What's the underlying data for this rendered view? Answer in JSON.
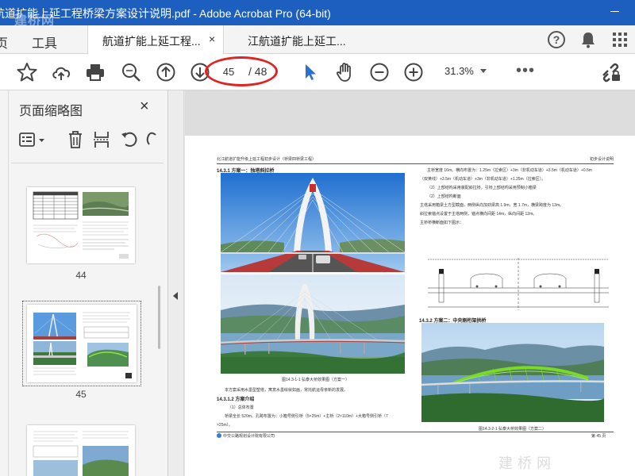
{
  "window": {
    "title": "航道扩能上延工程桥梁方案设计说明.pdf - Adobe Acrobat Pro (64-bit)",
    "watermark_text": "建桥网"
  },
  "tabs": {
    "home_label": "页",
    "tools_label": "工具",
    "active_doc_label": "航道扩能上延工程...",
    "second_doc_label": "江航道扩能上延工...",
    "close_symbol": "×",
    "help_symbol": "?"
  },
  "toolbar": {
    "current_page": "45",
    "total_pages": "/ 48",
    "zoom": "31.3%",
    "more_symbol": "•••",
    "annotation_color": "#e02424"
  },
  "left_panel": {
    "title": "页面缩略图",
    "close_symbol": "×",
    "thumbnails": [
      {
        "page_label": "44"
      },
      {
        "page_label": "45"
      }
    ]
  },
  "document": {
    "header_left": "北江航道扩能升级上延工程初步设计（桥梁四桥梁工程）",
    "header_right": "初步设计说明",
    "section_1": "14.3.1 方案一：独塔斜拉桥",
    "para_1": "本方案采用水墨型塑塔，寓意水墨绘就如画，常托航运母亲新的发展。",
    "section_1_2": "14.3.1.2 方案介绍",
    "para_2": "（1）总体布置",
    "para_3": "桥梁全长 520m。孔跨布置为：小箱号侧引桥（5×25m）+主桥（2×110m）+大箱号侧引桥（7",
    "para_4": "×25m）。",
    "caption_1": "图14.3-1-1  弘泰大桥效果图（方案一）",
    "right_para_1": "主桥宽度 16m。横向布置为：1.25m（拉索区）+3m（非机动车道）+3.5m（机动车道）+0.5m",
    "right_para_2": "（双黄线）+3.5m（机动车道）+3m（非机动车道）+1.25m（拉索区）。",
    "right_para_3": "（2）上部结构采用装配斜拉桥，引桥上部结构采用预制小箱梁",
    "right_para_4": "（2）上部结构断面",
    "right_para_5": "主塔采用箱梁土方型截面，两侧纵向加劲梁高 1.9m，宽 1.7m，横梁跨度为 13m。",
    "right_para_6": "斜拉索锚点设置于主塔两侧，锚点横向间距 14m，纵向间距 12m。",
    "right_para_7": "主桥桥横断面如下图示：",
    "section_2": "14.3.2 方案二：中央刚桁架拱桥",
    "caption_2": "图14.3-2-1  弘泰大桥效果图（方案二）",
    "footer_left": "中交公路规划设计院有限公司",
    "footer_right": "第 45 页"
  }
}
